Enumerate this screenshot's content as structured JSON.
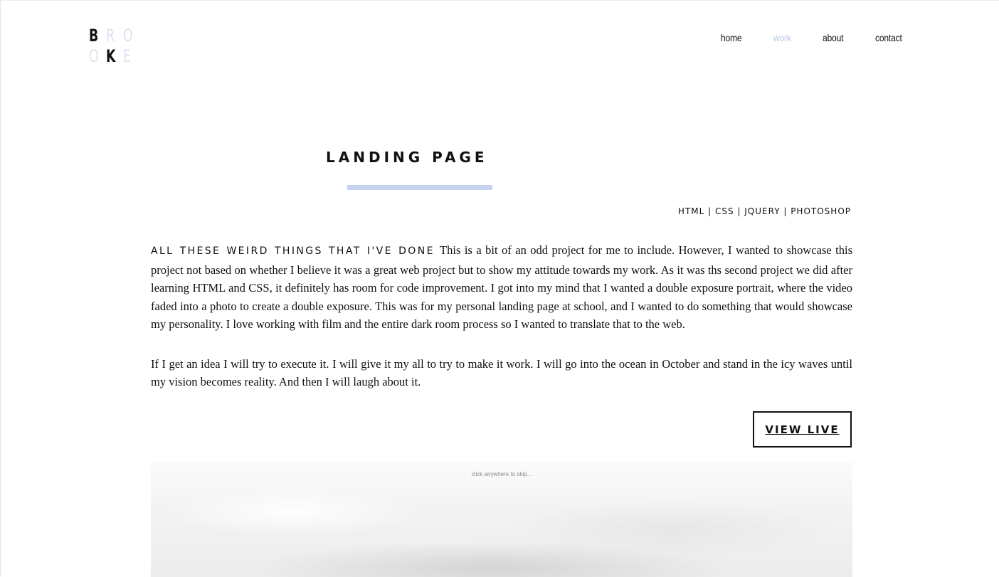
{
  "logo": {
    "letters": [
      "B",
      "R",
      "O",
      "O",
      "K",
      "E"
    ]
  },
  "nav": {
    "items": [
      {
        "label": "home"
      },
      {
        "label": "work"
      },
      {
        "label": "about"
      },
      {
        "label": "contact"
      }
    ],
    "active": "work"
  },
  "project": {
    "title": "LANDING PAGE",
    "technologies": "HTML | CSS | JQUERY | PHOTOSHOP",
    "lead": "ALL THESE WEIRD THINGS THAT I'VE DONE",
    "paragraph1": "This is a bit of an odd project for me to include. However, I wanted to showcase this project not based on whether I believe it was a great web project but to show my attitude towards my work. As it was ths second project we did after learning HTML and CSS, it definitely has room for code improvement. I got into my mind that I wanted a double exposure portrait, where the video faded into a photo to create a double exposure. This was for my personal landing page at school, and I wanted to do something that would showcase my personality. I love working with film and the entire dark room process so I wanted to translate that to the web.",
    "paragraph2": "If I get an idea I will try to execute it. I will give it my all to try to make it work. I will go into the ocean in October and stand in the icy waves until my vision becomes reality. And then I will laugh about it.",
    "view_live_label": "VIEW LIVE"
  },
  "preview": {
    "skip_text": "click anywhere to skip..."
  },
  "colors": {
    "accent": "#c6d3ef",
    "nav_active": "#b7c6e6",
    "text": "#111111"
  }
}
